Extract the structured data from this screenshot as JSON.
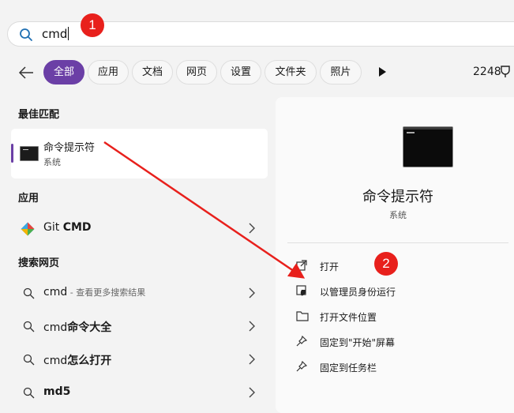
{
  "search": {
    "value": "cmd"
  },
  "annotations": {
    "badge1": "1",
    "badge2": "2",
    "arrow_color": "#e8201c"
  },
  "filters": {
    "chips": [
      "全部",
      "应用",
      "文档",
      "网页",
      "设置",
      "文件夹",
      "照片"
    ],
    "active": "全部",
    "points": "2248"
  },
  "best_match": {
    "heading": "最佳匹配",
    "title": "命令提示符",
    "subtitle": "系统"
  },
  "apps": {
    "heading": "应用",
    "items": [
      {
        "name_prefix": "Git ",
        "name_bold": "CMD"
      }
    ]
  },
  "web": {
    "heading": "搜索网页",
    "items": [
      {
        "text": "cmd",
        "hint": " - 查看更多搜索结果"
      },
      {
        "text": "cmd",
        "bold": "命令大全"
      },
      {
        "text": "cmd",
        "bold": "怎么打开"
      },
      {
        "text": "",
        "bold": "md5"
      }
    ]
  },
  "detail": {
    "title": "命令提示符",
    "subtitle": "系统",
    "actions": [
      {
        "label": "打开",
        "icon": "open-external-icon"
      },
      {
        "label": "以管理员身份运行",
        "icon": "shield-admin-icon"
      },
      {
        "label": "打开文件位置",
        "icon": "folder-icon"
      },
      {
        "label": "固定到\"开始\"屏幕",
        "icon": "pin-icon"
      },
      {
        "label": "固定到任务栏",
        "icon": "pin-icon"
      }
    ]
  },
  "colors": {
    "accent": "#6b3fa6",
    "badge": "#e8201c",
    "background": "#f3f3f3"
  }
}
